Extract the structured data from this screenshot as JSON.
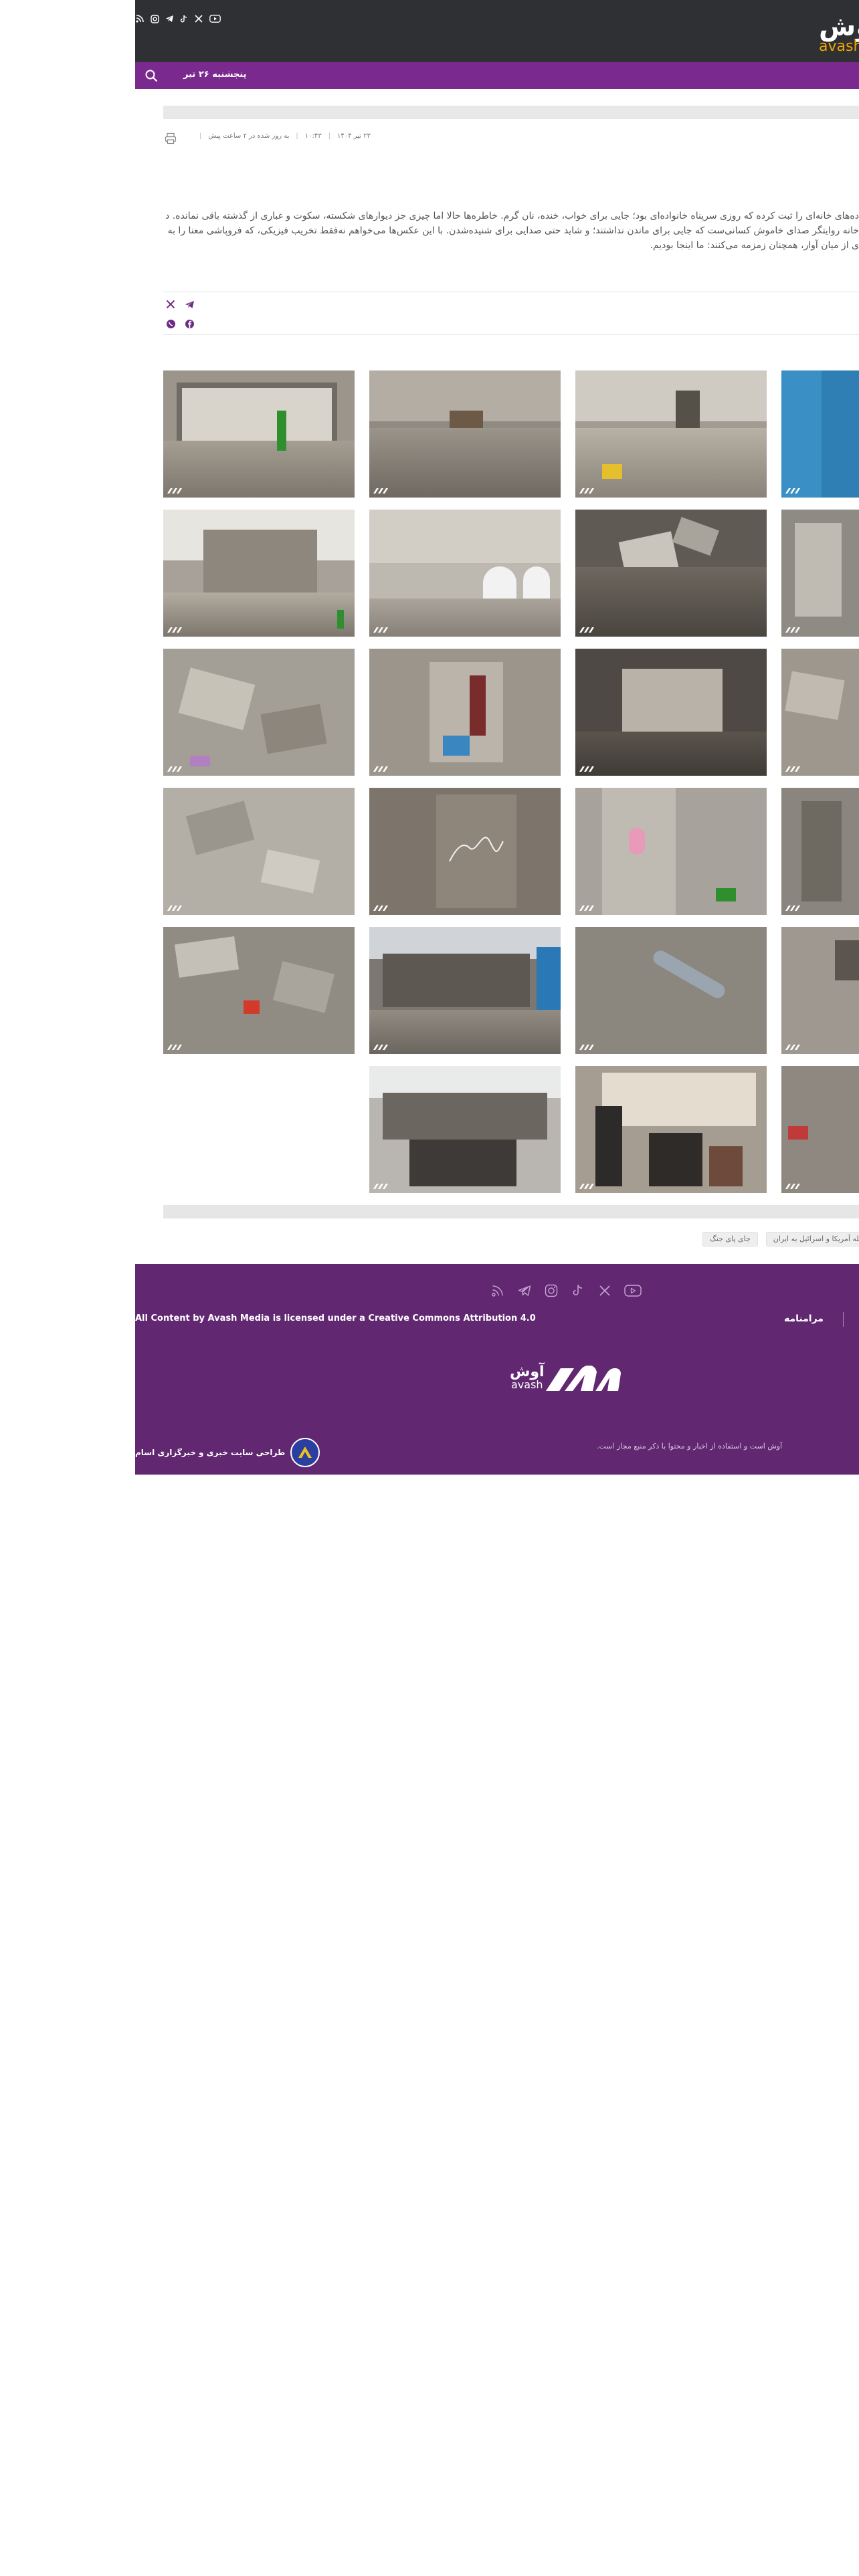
{
  "header": {
    "logo_fa": "آوش",
    "logo_en": "avash",
    "date": "پنجشنبه ۲۶ تیر",
    "social_icons": [
      "youtube-icon",
      "x-icon",
      "tiktok-icon",
      "telegram-icon",
      "instagram-icon",
      "rss-icon"
    ]
  },
  "article": {
    "meta": [
      "۲۳ تیر ۱۴۰۴",
      "۱۰:۴۳",
      "به روز شده در ۲ ساعت پیش"
    ],
    "lead_lines": [
      "ده‌های خانه‌ای را ثبت کرده که روزی سرپناه خانواده‌ای بود؛ جایی برای خواب، خنده، نان گرم. خاطره‌ها حالا اما چیزی جز دیوارهای شکسته، سکوت و غباری از گذشته باقی نمانده. در",
      "خانه روایتگر صدای خاموش کسانی‌ست که جایی برای ماندن نداشتند؛ و شاید حتی صدایی برای شنیده‌شدن. با این عکس‌ها می‌خواهم نه‌فقط تخریب فیزیکی، که فروپاشی معنا را به",
      "ی از میان آوار، همچنان زمزمه می‌کنند: ما اینجا بودیم."
    ],
    "share_icons": [
      "telegram-icon",
      "x-icon",
      "facebook-icon",
      "whatsapp-icon"
    ]
  },
  "tags": [
    "حمله آمریکا و اسرائیل به ایران",
    "جای پای جنگ"
  ],
  "footer": {
    "license": "All Content by Avash Media is licensed under a Creative Commons Attribution 4.0",
    "nav_label": "مرامنامه",
    "logo_fa": "آوش",
    "logo_en": "avash",
    "designer": "طراحی سایت خبری و خبرگزاری اسام",
    "notice": "آوش است و استفاده از اخبار و محتوا با ذکر منبع مجاز است.",
    "social_icons": [
      "youtube-icon",
      "x-icon",
      "tiktok-icon",
      "instagram-icon",
      "telegram-icon",
      "rss-icon"
    ]
  },
  "colors": {
    "header_bg": "#2e3034",
    "nav_bg": "#7a2a8e",
    "footer_bg": "#612771",
    "accent": "#f0a500"
  }
}
